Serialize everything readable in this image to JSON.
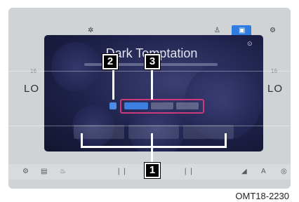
{
  "figure": {
    "modal_title": "Dark Temptation",
    "caption": "OMT18-2230",
    "side_left": {
      "num": "16",
      "lo": "LO"
    },
    "side_right": {
      "num": "16",
      "lo": "LO"
    },
    "callouts": [
      "1",
      "2",
      "3"
    ],
    "colors": {
      "accent": "#2f7de1",
      "highlight": "#cb3b7b",
      "modal": "#1e2149"
    },
    "icons": [
      "fan-icon",
      "seat-icon",
      "climate-icon",
      "settings-icon",
      "close-icon"
    ]
  }
}
